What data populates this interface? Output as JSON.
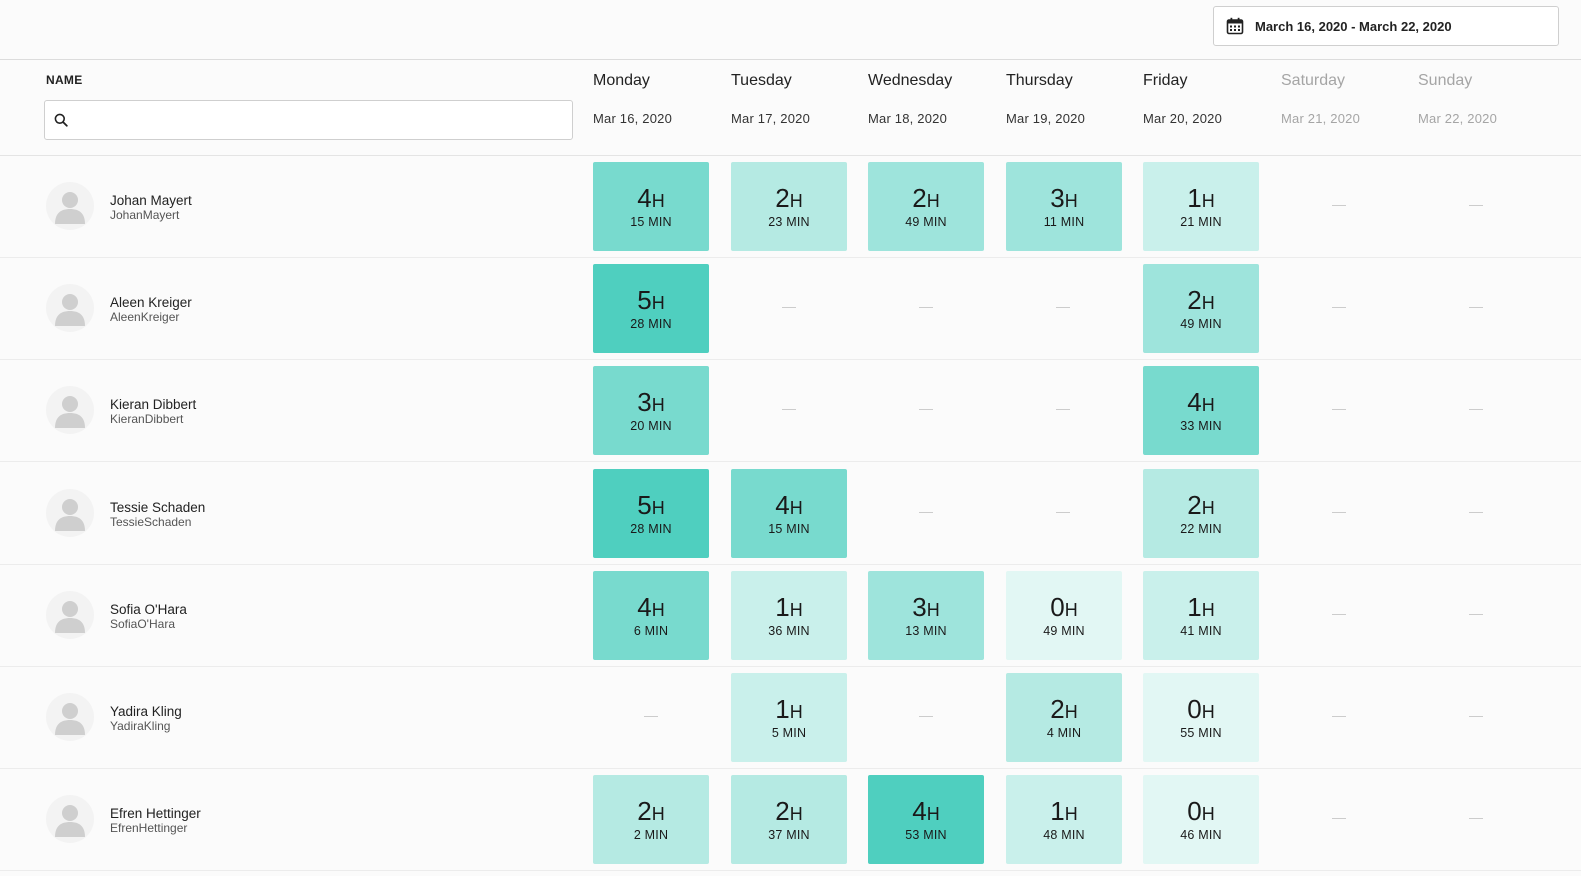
{
  "date_range": "March 16, 2020 - March 22, 2020",
  "name_header": "NAME",
  "search": {
    "value": "",
    "placeholder": ""
  },
  "days": [
    {
      "name": "Monday",
      "date": "Mar 16, 2020",
      "weekend": false
    },
    {
      "name": "Tuesday",
      "date": "Mar 17, 2020",
      "weekend": false
    },
    {
      "name": "Wednesday",
      "date": "Mar 18, 2020",
      "weekend": false
    },
    {
      "name": "Thursday",
      "date": "Mar 19, 2020",
      "weekend": false
    },
    {
      "name": "Friday",
      "date": "Mar 20, 2020",
      "weekend": false
    },
    {
      "name": "Saturday",
      "date": "Mar 21, 2020",
      "weekend": true
    },
    {
      "name": "Sunday",
      "date": "Mar 22, 2020",
      "weekend": true
    }
  ],
  "hour_unit": "H",
  "min_unit": "MIN",
  "colors": {
    "level_0": "#e2f7f4",
    "level_1": "#c9f0eb",
    "level_2": "#b5eae3",
    "level_3": "#9ee4dc",
    "level_4": "#78dace",
    "level_5": "#4fcfbf"
  },
  "people": [
    {
      "name": "Johan Mayert",
      "username": "JohanMayert",
      "entries": [
        {
          "h": 4,
          "m": 15
        },
        {
          "h": 2,
          "m": 23
        },
        {
          "h": 2,
          "m": 49
        },
        {
          "h": 3,
          "m": 11
        },
        {
          "h": 1,
          "m": 21
        },
        null,
        null
      ]
    },
    {
      "name": "Aleen Kreiger",
      "username": "AleenKreiger",
      "entries": [
        {
          "h": 5,
          "m": 28
        },
        null,
        null,
        null,
        {
          "h": 2,
          "m": 49
        },
        null,
        null
      ]
    },
    {
      "name": "Kieran Dibbert",
      "username": "KieranDibbert",
      "entries": [
        {
          "h": 3,
          "m": 20
        },
        null,
        null,
        null,
        {
          "h": 4,
          "m": 33
        },
        null,
        null
      ]
    },
    {
      "name": "Tessie Schaden",
      "username": "TessieSchaden",
      "entries": [
        {
          "h": 5,
          "m": 28
        },
        {
          "h": 4,
          "m": 15
        },
        null,
        null,
        {
          "h": 2,
          "m": 22
        },
        null,
        null
      ]
    },
    {
      "name": "Sofia O'Hara",
      "username": "SofiaO'Hara",
      "entries": [
        {
          "h": 4,
          "m": 6
        },
        {
          "h": 1,
          "m": 36
        },
        {
          "h": 3,
          "m": 13
        },
        {
          "h": 0,
          "m": 49
        },
        {
          "h": 1,
          "m": 41
        },
        null,
        null
      ]
    },
    {
      "name": "Yadira Kling",
      "username": "YadiraKling",
      "entries": [
        null,
        {
          "h": 1,
          "m": 5
        },
        null,
        {
          "h": 2,
          "m": 4
        },
        {
          "h": 0,
          "m": 55
        },
        null,
        null
      ]
    },
    {
      "name": "Efren Hettinger",
      "username": "EfrenHettinger",
      "entries": [
        {
          "h": 2,
          "m": 2
        },
        {
          "h": 2,
          "m": 37
        },
        {
          "h": 4,
          "m": 53
        },
        {
          "h": 1,
          "m": 48
        },
        {
          "h": 0,
          "m": 46
        },
        null,
        null
      ]
    }
  ]
}
